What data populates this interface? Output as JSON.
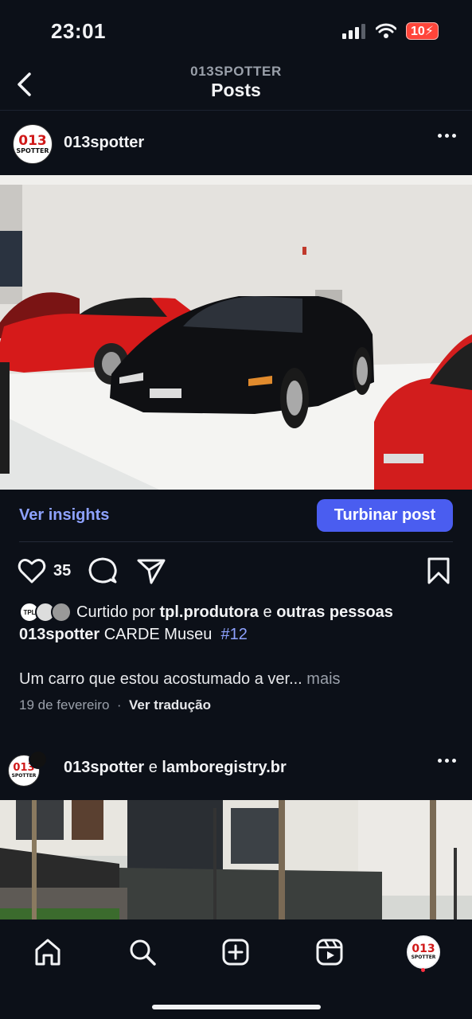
{
  "status_bar": {
    "time": "23:01",
    "battery": "10"
  },
  "header": {
    "subtitle": "013SPOTTER",
    "title": "Posts"
  },
  "post": {
    "username": "013spotter",
    "avatar_text": {
      "num": "013",
      "word": "SPOTTER"
    },
    "insights_label": "Ver insights",
    "boost_label": "Turbinar post",
    "likes": "35",
    "liked_by_prefix": "Curtido por",
    "liked_by_user": "tpl.produtora",
    "liked_by_join": "e",
    "liked_by_rest": "outras pessoas",
    "caption_user": "013spotter",
    "caption_text": "CARDE Museu",
    "caption_tag": "#12",
    "description": "Um carro que estou acostumado a ver...",
    "more_label": "mais",
    "date": "19 de fevereiro",
    "date_sep": "·",
    "translate_label": "Ver tradução",
    "mini_avatar_1": "TPL"
  },
  "post2": {
    "user1": "013spotter",
    "join": "e",
    "user2": "lamboregistry.br"
  },
  "colors": {
    "accent": "#4a5df0",
    "link": "#8ea2ff",
    "background": "#0c1018"
  }
}
